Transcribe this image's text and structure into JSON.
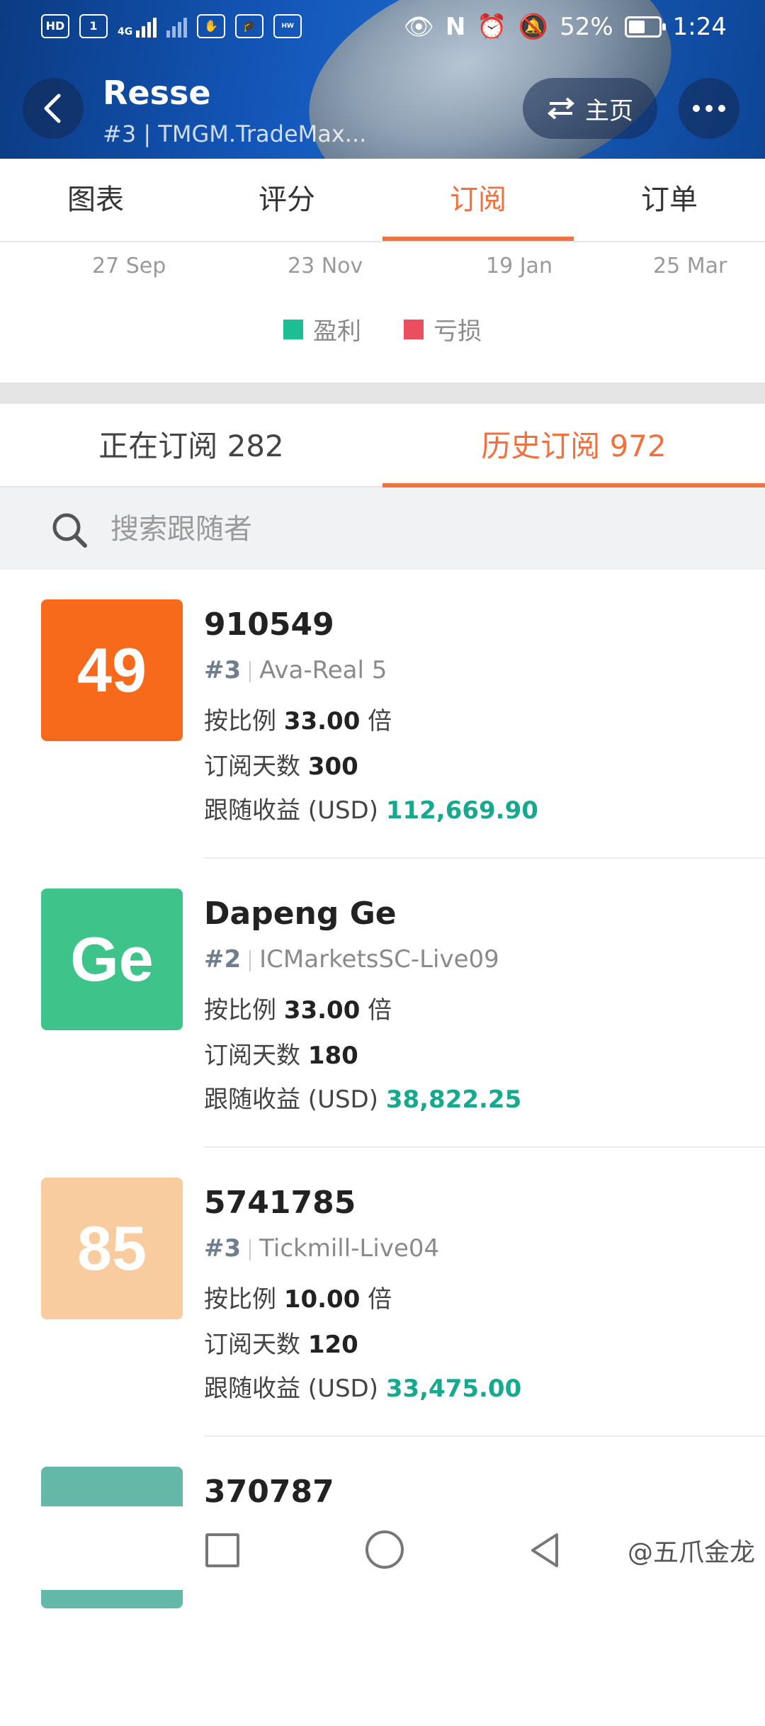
{
  "status_bar": {
    "left_icons": [
      "HD",
      "1",
      "4G",
      "HD"
    ],
    "battery": "52%",
    "time": "1:24"
  },
  "header": {
    "title": "Resse",
    "subtitle": "#3 | TMGM.TradeMax...",
    "home_label": "主页"
  },
  "top_tabs": [
    {
      "label": "图表"
    },
    {
      "label": "评分"
    },
    {
      "label": "订阅"
    },
    {
      "label": "订单"
    }
  ],
  "chart_data": {
    "type": "bar",
    "categories": [
      "27 Sep",
      "23 Nov",
      "19 Jan",
      "25 Mar"
    ],
    "series": [
      {
        "name": "盈利",
        "color": "#1dbf92"
      },
      {
        "name": "亏损",
        "color": "#ea4e5f"
      }
    ]
  },
  "sub_tabs": [
    {
      "label": "正在订阅 282"
    },
    {
      "label": "历史订阅 972"
    }
  ],
  "search": {
    "placeholder": "搜索跟随者"
  },
  "followers": [
    {
      "avatar_text": "49",
      "avatar_color": "#f86a1b",
      "name": "910549",
      "rank": "#3",
      "server": "Ava-Real 5",
      "ratio_label": "按比例",
      "ratio_value": "33.00",
      "ratio_unit": "倍",
      "days_label": "订阅天数",
      "days_value": "300",
      "profit_label": "跟随收益 (USD)",
      "profit_value": "112,669.90"
    },
    {
      "avatar_text": "Ge",
      "avatar_color": "#3ec48b",
      "name": "Dapeng Ge",
      "rank": "#2",
      "server": "ICMarketsSC-Live09",
      "ratio_label": "按比例",
      "ratio_value": "33.00",
      "ratio_unit": "倍",
      "days_label": "订阅天数",
      "days_value": "180",
      "profit_label": "跟随收益 (USD)",
      "profit_value": "38,822.25"
    },
    {
      "avatar_text": "85",
      "avatar_color": "#f8cc9f",
      "name": "5741785",
      "rank": "#3",
      "server": "Tickmill-Live04",
      "ratio_label": "按比例",
      "ratio_value": "10.00",
      "ratio_unit": "倍",
      "days_label": "订阅天数",
      "days_value": "120",
      "profit_label": "跟随收益 (USD)",
      "profit_value": "33,475.00"
    },
    {
      "avatar_text": "",
      "avatar_color": "#64b8a8",
      "name": "370787"
    }
  ],
  "watermark": "@五爪金龙"
}
